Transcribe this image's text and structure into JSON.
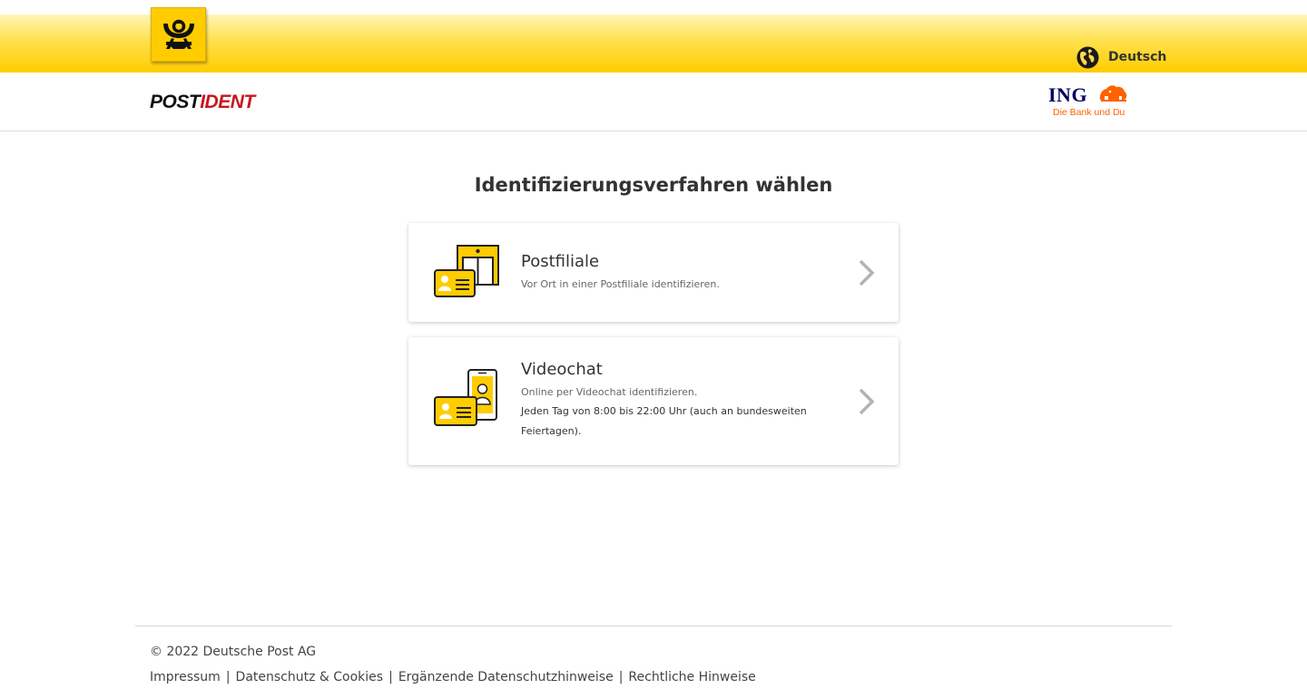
{
  "header": {
    "language_label": "Deutsch"
  },
  "subheader": {
    "brand_part1": "POST",
    "brand_part2": "IDENT",
    "partner_name": "ING",
    "partner_tagline": "Die Bank und Du"
  },
  "main": {
    "title": "Identifizierungsverfahren wählen",
    "options": [
      {
        "title": "Postfiliale",
        "description": "Vor Ort in einer Postfiliale identifizieren."
      },
      {
        "title": "Videochat",
        "description": "Online per Videochat identifizieren.",
        "hours": "Jeden Tag von 8:00 bis 22:00 Uhr (auch an bundesweiten Feiertagen)."
      }
    ]
  },
  "footer": {
    "copyright": "© 2022 Deutsche Post AG",
    "links": [
      "Impressum",
      "Datenschutz & Cookies",
      "Ergänzende Datenschutzhinweise",
      "Rechtliche Hinweise"
    ],
    "separator": "|"
  },
  "colors": {
    "brand_yellow": "#ffcc00",
    "postident_red": "#c8161d",
    "ing_orange": "#ff6200",
    "ing_blue": "#000066"
  }
}
